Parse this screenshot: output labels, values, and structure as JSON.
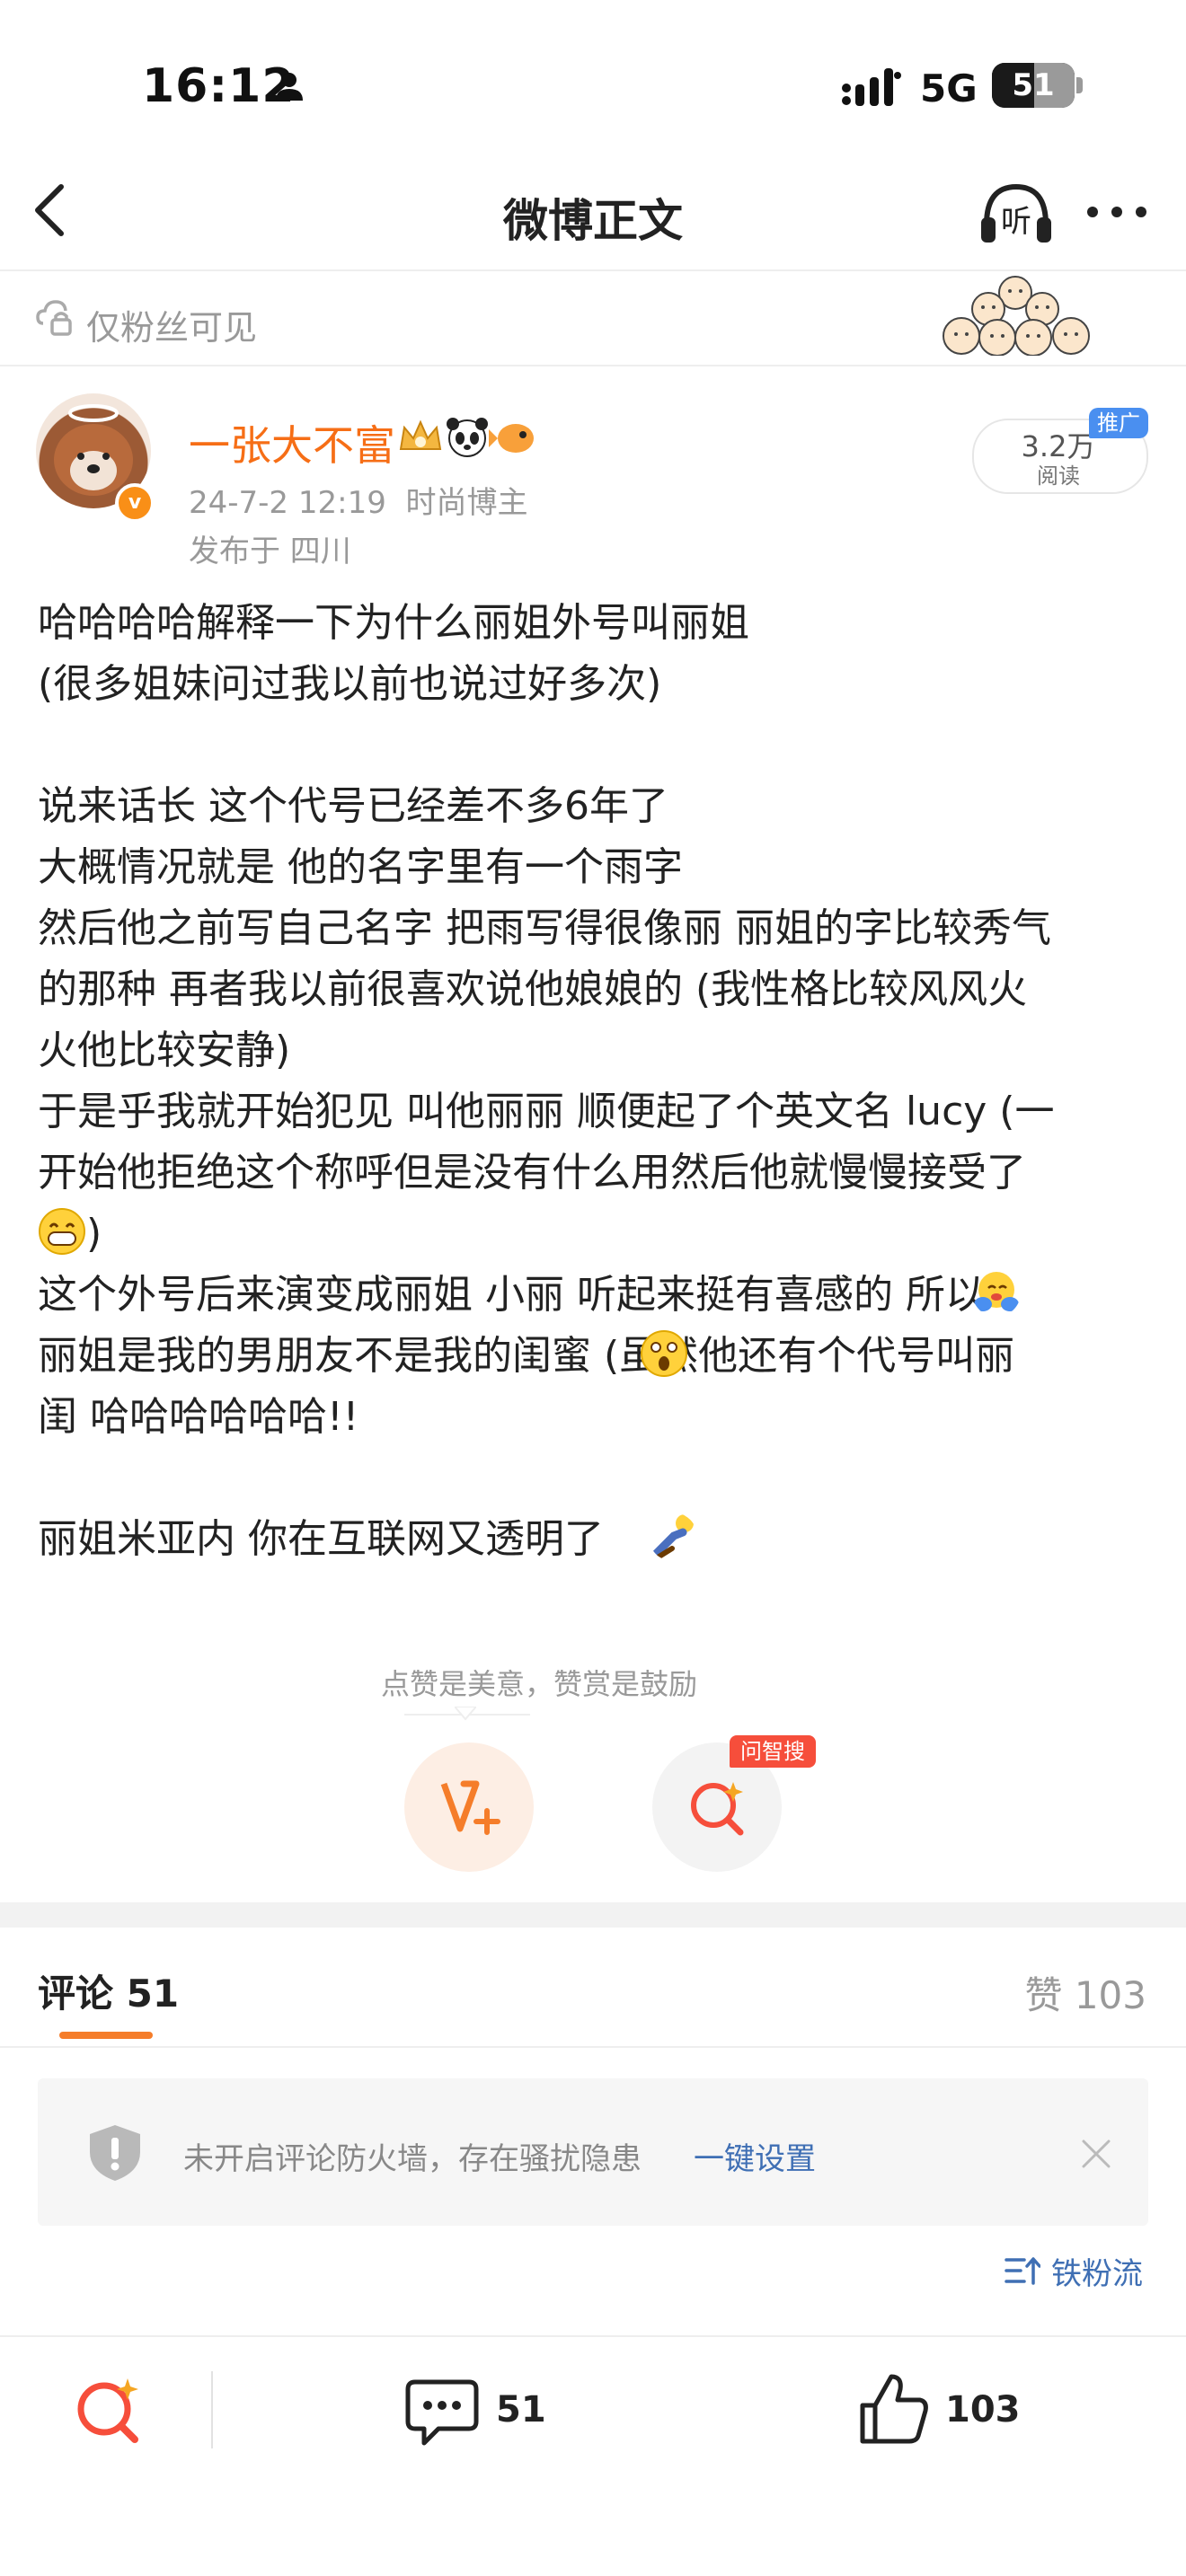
{
  "status_bar": {
    "time": "16:12",
    "network": "5G",
    "battery": "51",
    "battery_level": 0.51
  },
  "nav": {
    "title": "微博正文",
    "listen_label": "听"
  },
  "visibility": {
    "label": "仅粉丝可见"
  },
  "author": {
    "name": "一张大不富",
    "date": "24-7-2 12:19",
    "tag": "时尚博主",
    "location": "发布于 四川",
    "verified_mark": "v",
    "reads_count": "3.2万",
    "reads_label": "阅读",
    "promo_label": "推广"
  },
  "post": {
    "lines": [
      "哈哈哈哈解释一下为什么丽姐外号叫丽姐",
      "(很多姐妹问过我以前也说过好多次)",
      "",
      "说来话长 这个代号已经差不多6年了",
      "大概情况就是 他的名字里有一个雨字",
      "然后他之前写自己名字 把雨写得很像丽 丽姐的字比较秀气",
      "的那种 再者我以前很喜欢说他娘娘的 (我性格比较风风火",
      "火他比较安静)",
      "于是乎我就开始犯见 叫他丽丽 顺便起了个英文名 lucy (一",
      "开始他拒绝这个称呼但是没有什么用然后他就慢慢接受了",
      ")",
      "这个外号后来演变成丽姐 小丽 听起来挺有喜感的 所以",
      "丽姐是我的男朋友不是我的闺蜜 (虽然他还有个代号叫丽",
      "闺 哈哈哈哈哈哈!!",
      "",
      "丽姐米亚内 你在互联网又透明了"
    ]
  },
  "reward": {
    "hint": "点赞是美意，赞赏是鼓励",
    "search_tag": "问智搜"
  },
  "comments": {
    "tab_label": "评论 51",
    "likes_label": "赞 103",
    "firewall_text": "未开启评论防火墙，存在骚扰隐患",
    "firewall_link": "一键设置",
    "sort_label": "铁粉流"
  },
  "bottom_bar": {
    "comment_count": "51",
    "like_count": "103"
  },
  "colors": {
    "accent": "#f57d2a",
    "author": "#f66e16",
    "link": "#3f6fb4",
    "promo": "#4a8ff0",
    "search_tag": "#f64e3b"
  },
  "icons": [
    "person-icon",
    "signal-icon",
    "back-chevron-icon",
    "headphones-icon",
    "more-icon",
    "cloud-lock-icon",
    "emoji-crowd-icon",
    "crown-icon",
    "panda-icon",
    "fish-icon",
    "grin-emoji-icon",
    "hug-emoji-icon",
    "shock-emoji-icon",
    "kneel-emoji-icon",
    "reward-icon",
    "smart-search-icon",
    "shield-icon",
    "close-icon",
    "sort-icon",
    "comment-icon",
    "thumbs-up-icon"
  ]
}
